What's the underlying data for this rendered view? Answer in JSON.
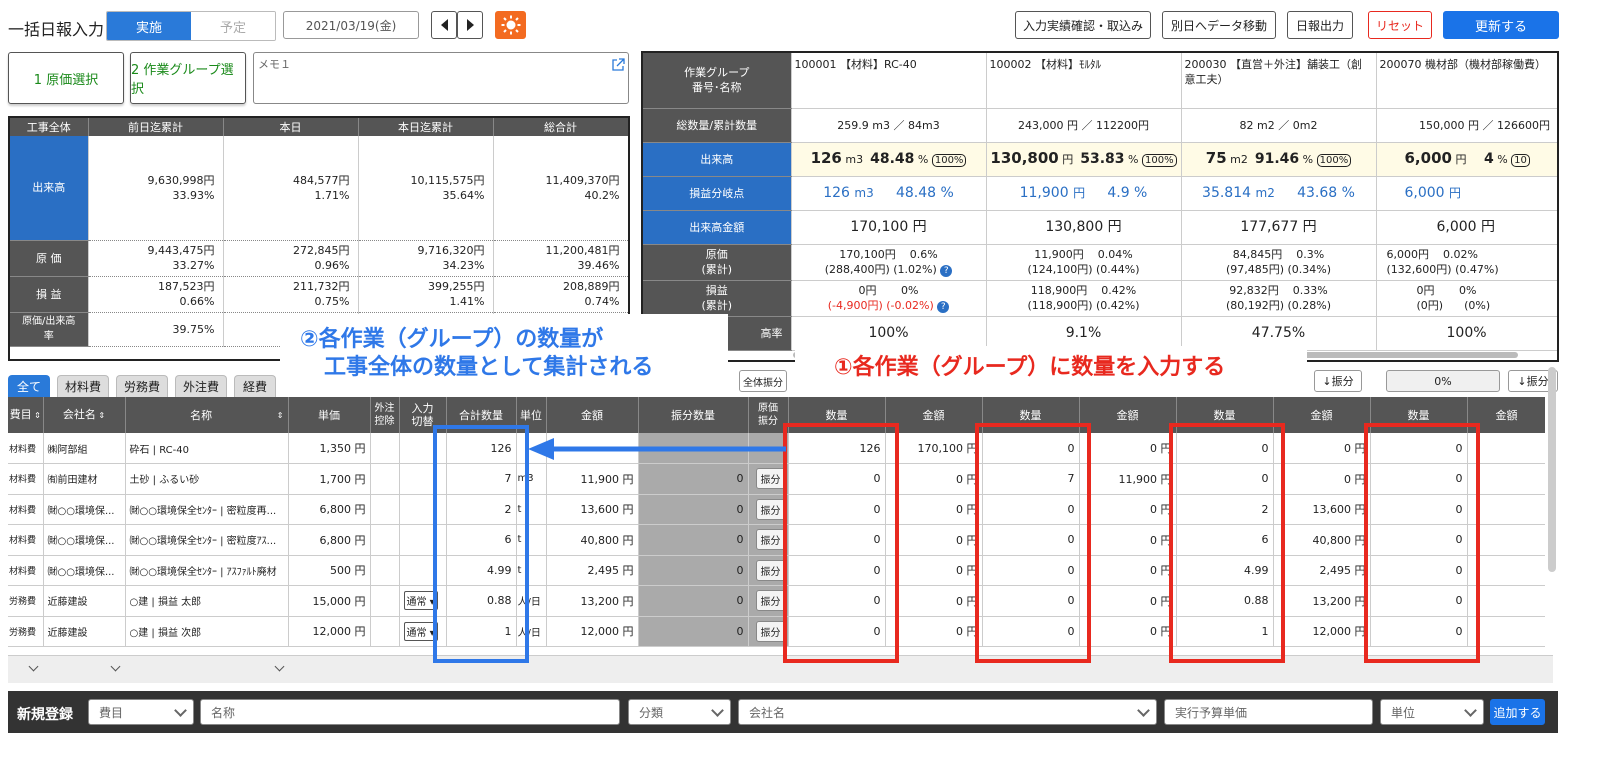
{
  "header": {
    "title": "一括日報入力",
    "mode_on": "実施",
    "mode_off": "予定",
    "date": "2021/03/19(金)",
    "btn_confirm": "入力実績確認・取込み",
    "btn_move": "別日へデータ移動",
    "btn_report": "日報出力",
    "btn_reset": "リセット",
    "btn_update": "更新する"
  },
  "select": {
    "cost": "1 原価選択",
    "group": "2 作業グループ選択",
    "memo_placeholder": "メモ１"
  },
  "summary": {
    "headers": [
      "工事全体",
      "前日迄累計",
      "本日",
      "本日迄累計",
      "総合計"
    ],
    "rows": [
      {
        "label": "出来高",
        "cells": [
          [
            "9,630,998円",
            "33.93%"
          ],
          [
            "484,577円",
            "1.71%"
          ],
          [
            "10,115,575円",
            "35.64%"
          ],
          [
            "11,409,370円",
            "40.2%"
          ]
        ]
      },
      {
        "label": "原 価",
        "cells": [
          [
            "9,443,475円",
            "33.27%"
          ],
          [
            "272,845円",
            "0.96%"
          ],
          [
            "9,716,320円",
            "34.23%"
          ],
          [
            "11,200,481円",
            "39.46%"
          ]
        ]
      },
      {
        "label": "損 益",
        "cells": [
          [
            "187,523円",
            "0.66%"
          ],
          [
            "211,732円",
            "0.75%"
          ],
          [
            "399,255円",
            "1.41%"
          ],
          [
            "208,889円",
            "0.74%"
          ]
        ]
      },
      {
        "label": "原価/出来高率",
        "cells": [
          [
            "39.75%"
          ],
          [
            ""
          ],
          [
            ""
          ],
          [
            ""
          ]
        ]
      }
    ]
  },
  "groups": {
    "row_labels": [
      "作業グループ\n番号･名称",
      "総数量/累計数量",
      "出来高",
      "損益分岐点",
      "出来高金額",
      "原価\n(累計)",
      "損益\n(累計)",
      "高率"
    ],
    "cols": [
      {
        "name": "100001 【材料】RC-40",
        "total": "259.9 m3 ／ 84m3",
        "dq": "126",
        "du": "m3",
        "dp": "48.48",
        "dpu": "%",
        "full": "100%",
        "bq": "126",
        "bu": "m3",
        "bp": "48.48 %",
        "amount": "170,100 円",
        "cost1": "170,100円",
        "cost1p": "0.6%",
        "cost2": "(288,400円)",
        "cost2p": "(1.02%)",
        "pl1": "0円",
        "pl1p": "0%",
        "pl2": "(-4,900円)",
        "pl2p": "(-0.02%)",
        "rate": "100%"
      },
      {
        "name": "100002 【材料】ﾓﾙﾀﾙ",
        "total": "243,000 円 ／ 112200円",
        "dq": "130,800",
        "du": "円",
        "dp": "53.83",
        "dpu": "%",
        "full": "100%",
        "bq": "11,900",
        "bu": "円",
        "bp": "4.9 %",
        "amount": "130,800 円",
        "cost1": "11,900円",
        "cost1p": "0.04%",
        "cost2": "(124,100円)",
        "cost2p": "(0.44%)",
        "pl1": "118,900円",
        "pl1p": "0.42%",
        "pl2": "(118,900円)",
        "pl2p": "(0.42%)",
        "rate": "9.1%"
      },
      {
        "name": "200030 【直営＋外注】舗装工（創意工夫）",
        "total": "82 m2 ／ 0m2",
        "dq": "75",
        "du": "m2",
        "dp": "91.46",
        "dpu": "%",
        "full": "100%",
        "bq": "35.814",
        "bu": "m2",
        "bp": "43.68 %",
        "amount": "177,677 円",
        "cost1": "84,845円",
        "cost1p": "0.3%",
        "cost2": "(97,485円)",
        "cost2p": "(0.34%)",
        "pl1": "92,832円",
        "pl1p": "0.33%",
        "pl2": "(80,192円)",
        "pl2p": "(0.28%)",
        "rate": "47.75%"
      },
      {
        "name": "200070 機材部（機材部稼働費）",
        "total": "150,000 円 ／ 126600円",
        "dq": "6,000",
        "du": "円",
        "dp": "4",
        "dpu": "%",
        "full": "10",
        "bq": "6,000",
        "bu": "円",
        "bp": "",
        "amount": "6,000 円",
        "cost1": "6,000円",
        "cost1p": "0.02%",
        "cost2": "(132,600円)",
        "cost2p": "(0.47%)",
        "pl1": "0円",
        "pl1p": "0%",
        "pl2": "(0円)",
        "pl2p": "(0%)",
        "rate": "100%"
      }
    ]
  },
  "tabs": [
    "全て",
    "材料費",
    "労務費",
    "外注費",
    "経費"
  ],
  "grid_ctrl": {
    "allocate_all": "全体振分",
    "allocate": "↓振分",
    "allocate2": "↓振分",
    "percent": "0%"
  },
  "grid": {
    "headers": [
      "費目",
      "会社名",
      "名称",
      "単価",
      "外注\n控除",
      "入力\n切替",
      "合計数量",
      "単位",
      "金額",
      "振分数量",
      "原価\n振分",
      "数量",
      "金額",
      "数量",
      "金額",
      "数量",
      "金額",
      "数量",
      "金額"
    ],
    "rows": [
      {
        "cat": "材料費",
        "co": "㈱阿部組",
        "name": "砕石 | RC-40",
        "price": "1,350 円",
        "sel": "",
        "sum": "126",
        "unit": "",
        "amt": "",
        "alloc": "",
        "btn": "",
        "v": [
          "126",
          "170,100 円",
          "0",
          "0 円",
          "0",
          "0 円",
          "0"
        ]
      },
      {
        "cat": "材料費",
        "co": "㈲前田建材",
        "name": "土砂 | ふるい砂",
        "price": "1,700 円",
        "sel": "",
        "sum": "7",
        "unit": "m3",
        "amt": "11,900 円",
        "alloc": "0",
        "btn": "振分",
        "v": [
          "0",
          "0 円",
          "7",
          "11,900 円",
          "0",
          "0 円",
          "0"
        ]
      },
      {
        "cat": "材料費",
        "co": "㈶○○環境保...",
        "name": "㈶○○環境保全ｾﾝﾀｰ | 密粒度再...",
        "price": "6,800 円",
        "sel": "",
        "sum": "2",
        "unit": "t",
        "amt": "13,600 円",
        "alloc": "0",
        "btn": "振分",
        "v": [
          "0",
          "0 円",
          "0",
          "0 円",
          "2",
          "13,600 円",
          "0"
        ]
      },
      {
        "cat": "材料費",
        "co": "㈶○○環境保...",
        "name": "㈶○○環境保全ｾﾝﾀｰ | 密粒度ｱｽ...",
        "price": "6,800 円",
        "sel": "",
        "sum": "6",
        "unit": "t",
        "amt": "40,800 円",
        "alloc": "0",
        "btn": "振分",
        "v": [
          "0",
          "0 円",
          "0",
          "0 円",
          "6",
          "40,800 円",
          "0"
        ]
      },
      {
        "cat": "材料費",
        "co": "㈶○○環境保...",
        "name": "㈶○○環境保全ｾﾝﾀｰ | ｱｽﾌｧﾙﾄ廃材",
        "price": "500 円",
        "sel": "",
        "sum": "4.99",
        "unit": "t",
        "amt": "2,495 円",
        "alloc": "0",
        "btn": "振分",
        "v": [
          "0",
          "0 円",
          "0",
          "0 円",
          "4.99",
          "2,495 円",
          "0"
        ]
      },
      {
        "cat": "労務費",
        "co": "近藤建設",
        "name": "○建 | 損益 太郎",
        "price": "15,000 円",
        "sel": "通常",
        "sum": "0.88",
        "unit": "人/日",
        "amt": "13,200 円",
        "alloc": "0",
        "btn": "振分",
        "v": [
          "0",
          "0 円",
          "0",
          "0 円",
          "0.88",
          "13,200 円",
          "0"
        ]
      },
      {
        "cat": "労務費",
        "co": "近藤建設",
        "name": "○建 | 損益 次郎",
        "price": "12,000 円",
        "sel": "通常",
        "sum": "1",
        "unit": "人/日",
        "amt": "12,000 円",
        "alloc": "0",
        "btn": "振分",
        "v": [
          "0",
          "0 円",
          "0",
          "0 円",
          "1",
          "12,000 円",
          "0"
        ]
      }
    ]
  },
  "annotations": {
    "left_line1": "②各作業（グループ）の数量が",
    "left_line2": "工事全体の数量として集計される",
    "right": "①各作業（グループ）に数量を入力する"
  },
  "new_entry": {
    "label": "新規登録",
    "cat": "費目",
    "name": "名称",
    "class": "分類",
    "company": "会社名",
    "price": "実行予算単価",
    "unit": "単位",
    "add": "追加する"
  }
}
